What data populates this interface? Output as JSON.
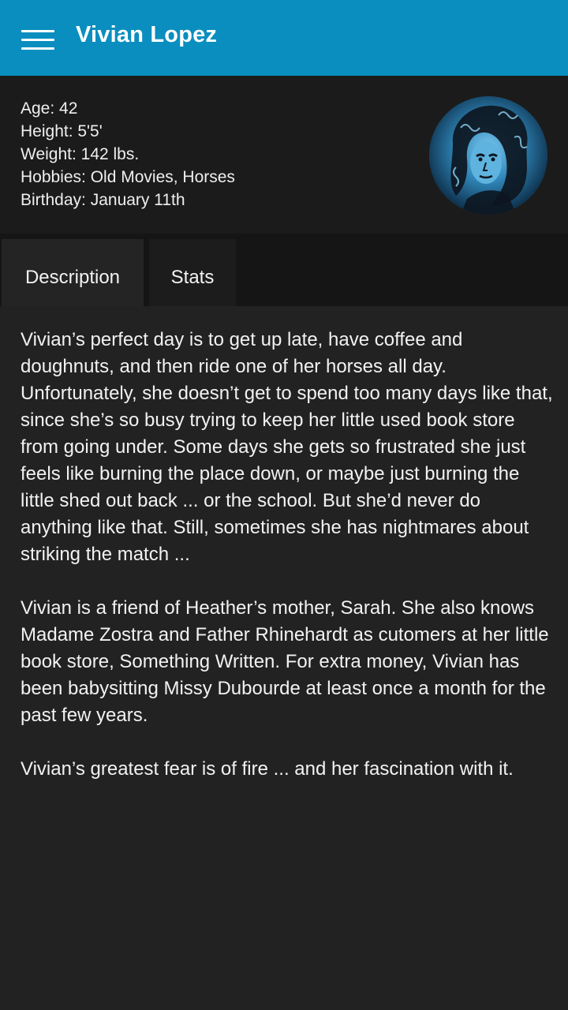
{
  "header": {
    "title": "Vivian Lopez",
    "menu_icon": "hamburger-menu-icon",
    "background_color": "#0a8ebf"
  },
  "profile": {
    "age": "Age: 42",
    "height": "Height: 5'5'",
    "weight": "Weight: 142 lbs.",
    "hobbies": "Hobbies: Old Movies, Horses",
    "birthday": "Birthday: January 11th"
  },
  "tabs": [
    {
      "label": "Description",
      "selected": true
    },
    {
      "label": "Stats",
      "selected": false
    }
  ],
  "description": {
    "paragraphs": [
      "Vivian’s perfect day is to get up late, have coffee and doughnuts, and then ride one of her horses all day. Unfortunately, she doesn’t get to spend too many days like that, since she’s so busy trying to keep her little used book store from going under. Some days she gets so frustrated she just feels like burning the place down, or maybe just burning the little shed out back ... or the school. But she’d never do anything like that. Still, sometimes she has nightmares about striking the match ...",
      "Vivian is a friend of Heather’s mother, Sarah. She also knows Madame Zostra and Father Rhinehardt as cutomers at her little book store, Something Written. For extra money, Vivian has been babysitting Missy Dubourde at least once a month for the past few years.",
      "Vivian’s greatest fear is of fire ... and her fascination with it."
    ]
  }
}
